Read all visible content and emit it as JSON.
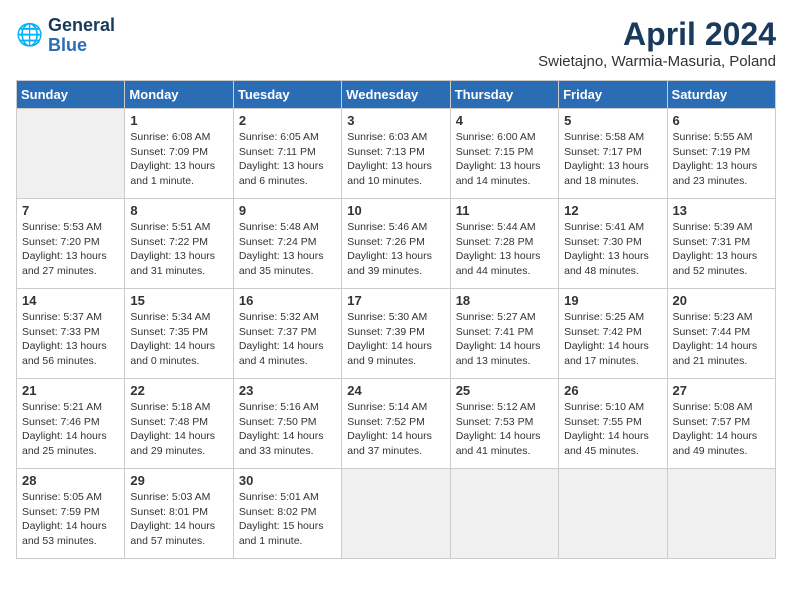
{
  "header": {
    "logo_line1": "General",
    "logo_line2": "Blue",
    "month_title": "April 2024",
    "location": "Swietajno, Warmia-Masuria, Poland"
  },
  "days_of_week": [
    "Sunday",
    "Monday",
    "Tuesday",
    "Wednesday",
    "Thursday",
    "Friday",
    "Saturday"
  ],
  "weeks": [
    [
      {
        "num": "",
        "info": ""
      },
      {
        "num": "1",
        "info": "Sunrise: 6:08 AM\nSunset: 7:09 PM\nDaylight: 13 hours\nand 1 minute."
      },
      {
        "num": "2",
        "info": "Sunrise: 6:05 AM\nSunset: 7:11 PM\nDaylight: 13 hours\nand 6 minutes."
      },
      {
        "num": "3",
        "info": "Sunrise: 6:03 AM\nSunset: 7:13 PM\nDaylight: 13 hours\nand 10 minutes."
      },
      {
        "num": "4",
        "info": "Sunrise: 6:00 AM\nSunset: 7:15 PM\nDaylight: 13 hours\nand 14 minutes."
      },
      {
        "num": "5",
        "info": "Sunrise: 5:58 AM\nSunset: 7:17 PM\nDaylight: 13 hours\nand 18 minutes."
      },
      {
        "num": "6",
        "info": "Sunrise: 5:55 AM\nSunset: 7:19 PM\nDaylight: 13 hours\nand 23 minutes."
      }
    ],
    [
      {
        "num": "7",
        "info": "Sunrise: 5:53 AM\nSunset: 7:20 PM\nDaylight: 13 hours\nand 27 minutes."
      },
      {
        "num": "8",
        "info": "Sunrise: 5:51 AM\nSunset: 7:22 PM\nDaylight: 13 hours\nand 31 minutes."
      },
      {
        "num": "9",
        "info": "Sunrise: 5:48 AM\nSunset: 7:24 PM\nDaylight: 13 hours\nand 35 minutes."
      },
      {
        "num": "10",
        "info": "Sunrise: 5:46 AM\nSunset: 7:26 PM\nDaylight: 13 hours\nand 39 minutes."
      },
      {
        "num": "11",
        "info": "Sunrise: 5:44 AM\nSunset: 7:28 PM\nDaylight: 13 hours\nand 44 minutes."
      },
      {
        "num": "12",
        "info": "Sunrise: 5:41 AM\nSunset: 7:30 PM\nDaylight: 13 hours\nand 48 minutes."
      },
      {
        "num": "13",
        "info": "Sunrise: 5:39 AM\nSunset: 7:31 PM\nDaylight: 13 hours\nand 52 minutes."
      }
    ],
    [
      {
        "num": "14",
        "info": "Sunrise: 5:37 AM\nSunset: 7:33 PM\nDaylight: 13 hours\nand 56 minutes."
      },
      {
        "num": "15",
        "info": "Sunrise: 5:34 AM\nSunset: 7:35 PM\nDaylight: 14 hours\nand 0 minutes."
      },
      {
        "num": "16",
        "info": "Sunrise: 5:32 AM\nSunset: 7:37 PM\nDaylight: 14 hours\nand 4 minutes."
      },
      {
        "num": "17",
        "info": "Sunrise: 5:30 AM\nSunset: 7:39 PM\nDaylight: 14 hours\nand 9 minutes."
      },
      {
        "num": "18",
        "info": "Sunrise: 5:27 AM\nSunset: 7:41 PM\nDaylight: 14 hours\nand 13 minutes."
      },
      {
        "num": "19",
        "info": "Sunrise: 5:25 AM\nSunset: 7:42 PM\nDaylight: 14 hours\nand 17 minutes."
      },
      {
        "num": "20",
        "info": "Sunrise: 5:23 AM\nSunset: 7:44 PM\nDaylight: 14 hours\nand 21 minutes."
      }
    ],
    [
      {
        "num": "21",
        "info": "Sunrise: 5:21 AM\nSunset: 7:46 PM\nDaylight: 14 hours\nand 25 minutes."
      },
      {
        "num": "22",
        "info": "Sunrise: 5:18 AM\nSunset: 7:48 PM\nDaylight: 14 hours\nand 29 minutes."
      },
      {
        "num": "23",
        "info": "Sunrise: 5:16 AM\nSunset: 7:50 PM\nDaylight: 14 hours\nand 33 minutes."
      },
      {
        "num": "24",
        "info": "Sunrise: 5:14 AM\nSunset: 7:52 PM\nDaylight: 14 hours\nand 37 minutes."
      },
      {
        "num": "25",
        "info": "Sunrise: 5:12 AM\nSunset: 7:53 PM\nDaylight: 14 hours\nand 41 minutes."
      },
      {
        "num": "26",
        "info": "Sunrise: 5:10 AM\nSunset: 7:55 PM\nDaylight: 14 hours\nand 45 minutes."
      },
      {
        "num": "27",
        "info": "Sunrise: 5:08 AM\nSunset: 7:57 PM\nDaylight: 14 hours\nand 49 minutes."
      }
    ],
    [
      {
        "num": "28",
        "info": "Sunrise: 5:05 AM\nSunset: 7:59 PM\nDaylight: 14 hours\nand 53 minutes."
      },
      {
        "num": "29",
        "info": "Sunrise: 5:03 AM\nSunset: 8:01 PM\nDaylight: 14 hours\nand 57 minutes."
      },
      {
        "num": "30",
        "info": "Sunrise: 5:01 AM\nSunset: 8:02 PM\nDaylight: 15 hours\nand 1 minute."
      },
      {
        "num": "",
        "info": ""
      },
      {
        "num": "",
        "info": ""
      },
      {
        "num": "",
        "info": ""
      },
      {
        "num": "",
        "info": ""
      }
    ]
  ]
}
